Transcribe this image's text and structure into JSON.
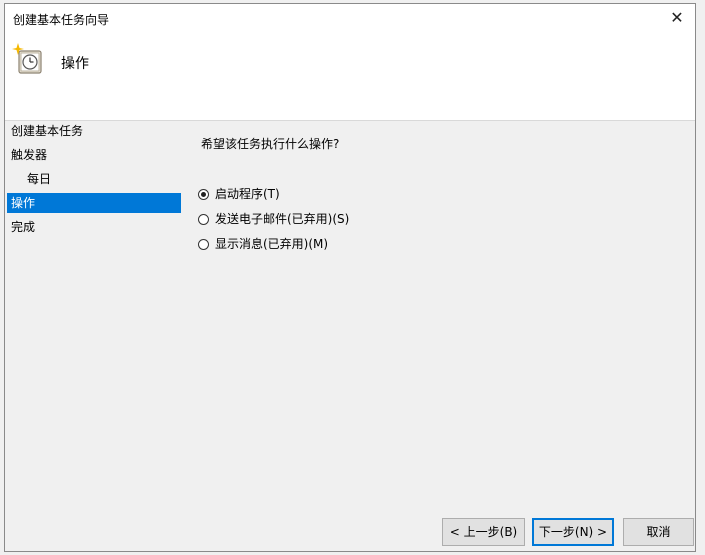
{
  "window": {
    "title": "创建基本任务向导",
    "close_symbol": "✕"
  },
  "header": {
    "title": "操作",
    "icon": "task-clock-icon"
  },
  "nav": {
    "items": [
      {
        "label": "创建基本任务"
      },
      {
        "label": "触发器"
      },
      {
        "label": "每日"
      },
      {
        "label": "操作"
      },
      {
        "label": "完成"
      }
    ]
  },
  "main": {
    "question": "希望该任务执行什么操作?",
    "options": [
      {
        "label": "启动程序(T)",
        "selected": true
      },
      {
        "label": "发送电子邮件(已弃用)(S)",
        "selected": false
      },
      {
        "label": "显示消息(已弃用)(M)",
        "selected": false
      }
    ]
  },
  "buttons": {
    "back": "< 上一步(B)",
    "next": "下一步(N) >",
    "cancel": "取消"
  },
  "colors": {
    "selection": "#0078d7",
    "background": "#f0f0f0",
    "header_bg": "#ffffff"
  }
}
